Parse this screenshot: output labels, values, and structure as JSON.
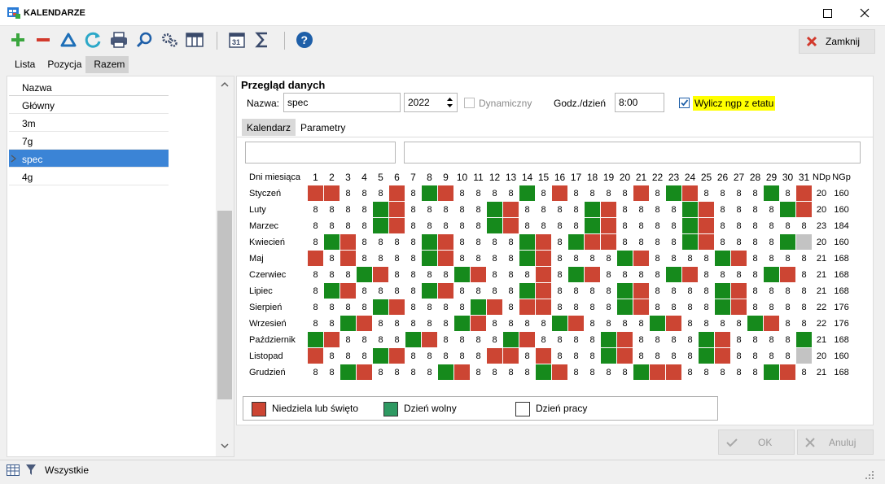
{
  "window": {
    "title": "KALENDARZE"
  },
  "toolbar": {
    "close_label": "Zamknij"
  },
  "top_tabs": [
    {
      "label": "Lista"
    },
    {
      "label": "Pozycja"
    },
    {
      "label": "Razem"
    }
  ],
  "list": {
    "header": "Nazwa",
    "items": [
      {
        "label": "Główny"
      },
      {
        "label": "3m"
      },
      {
        "label": "7g"
      },
      {
        "label": "spec"
      },
      {
        "label": "4g"
      }
    ],
    "selected": "spec"
  },
  "overview": {
    "title": "Przegląd danych",
    "name_label": "Nazwa:",
    "name_value": "spec",
    "year_value": "2022",
    "dynamic_label": "Dynamiczny",
    "hours_label": "Godz./dzień",
    "hours_value": "8:00",
    "wylicz_label": "Wylicz ngp z etatu"
  },
  "sub_tabs": [
    {
      "label": "Kalendarz"
    },
    {
      "label": "Parametry"
    }
  ],
  "calendar": {
    "header_label": "Dni miesiąca",
    "days": [
      "1",
      "2",
      "3",
      "4",
      "5",
      "6",
      "7",
      "8",
      "9",
      "10",
      "11",
      "12",
      "13",
      "14",
      "15",
      "16",
      "17",
      "18",
      "19",
      "20",
      "21",
      "22",
      "23",
      "24",
      "25",
      "26",
      "27",
      "28",
      "29",
      "30",
      "31"
    ],
    "ndp_label": "NDp",
    "ngp_label": "NGp",
    "months": [
      {
        "name": "Styczeń",
        "cells": "SS888S8WS8888W8S8888S8WS8888W8S8",
        "ndp": "20",
        "ngp": "160"
      },
      {
        "name": "Luty",
        "cells": "8888WS88888WS8888WS8888WS8888WS8GGG",
        "ndp": "20",
        "ngp": "160"
      },
      {
        "name": "Marzec",
        "cells": "8888WS88888WS8888WS8888WS88888888",
        "ndp": "23",
        "ngp": "184"
      },
      {
        "name": "Kwiecień",
        "cells": "8WS8888WS8888WS8WSS8888WS8888WG",
        "ndp": "20",
        "ngp": "160"
      },
      {
        "name": "Maj",
        "cells": "S8S8888WS8888WS8888WS8888WS8888WS8",
        "ndp": "21",
        "ngp": "168"
      },
      {
        "name": "Czerwiec",
        "cells": "888WS8888WS888S8WS8888WS8888WS888G",
        "ndp": "21",
        "ngp": "168"
      },
      {
        "name": "Lipiec",
        "cells": "8WS8888WS8888WS8888WS8888WS8888WS",
        "ndp": "21",
        "ngp": "168"
      },
      {
        "name": "Sierpień",
        "cells": "8888WS8888WS8SS8888WS8888WS8888WS8",
        "ndp": "22",
        "ngp": "176"
      },
      {
        "name": "Wrzesień",
        "cells": "88WS88888WS8888WS8888WS8888WS88G",
        "ndp": "22",
        "ngp": "176"
      },
      {
        "name": "Październik",
        "cells": "WS8888WS8888WS8888WS8888WS8888WS8",
        "ndp": "21",
        "ngp": "168"
      },
      {
        "name": "Listopad",
        "cells": "S888WS88888SS8S888WS8888WS8888G",
        "ndp": "20",
        "ngp": "160"
      },
      {
        "name": "Grudzień",
        "cells": "88WS8888WS8888WS8888WSS88888WS88W",
        "ndp": "21",
        "ngp": "168"
      }
    ]
  },
  "legend": [
    {
      "label": "Niedziela lub święto",
      "color": "#cc4533"
    },
    {
      "label": "Dzień wolny",
      "color": "#2e9962"
    },
    {
      "label": "Dzień pracy",
      "color": "#ffffff"
    }
  ],
  "buttons": {
    "ok": "OK",
    "cancel": "Anuluj"
  },
  "statusbar": {
    "filter_label": "Wszystkie"
  }
}
